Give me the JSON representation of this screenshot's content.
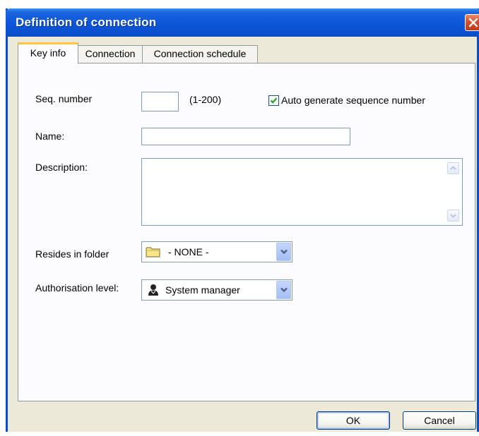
{
  "window": {
    "title": "Definition of connection"
  },
  "tabs": [
    {
      "label": "Key info",
      "active": true
    },
    {
      "label": "Connection",
      "active": false
    },
    {
      "label": "Connection schedule",
      "active": false
    }
  ],
  "form": {
    "seq_label": "Seq. number",
    "seq_value": "",
    "seq_range": "(1-200)",
    "auto_generate_label": "Auto generate sequence number",
    "auto_generate_checked": true,
    "name_label": "Name:",
    "name_value": "",
    "description_label": "Description:",
    "description_value": "",
    "folder_label": "Resides in folder",
    "folder_value": "- NONE -",
    "auth_label": "Authorisation level:",
    "auth_value": "System manager"
  },
  "buttons": {
    "ok": "OK",
    "cancel": "Cancel"
  },
  "colors": {
    "titlebar": "#0b55d8",
    "dialog_bg": "#ece9d8",
    "active_tab_accent": "#ffc83c",
    "close_button": "#d4502c"
  },
  "icons": {
    "close": "close-icon",
    "checkbox": "checkmark-icon",
    "folder": "folder-icon",
    "user": "user-icon",
    "dropdown": "chevron-down-icon"
  }
}
